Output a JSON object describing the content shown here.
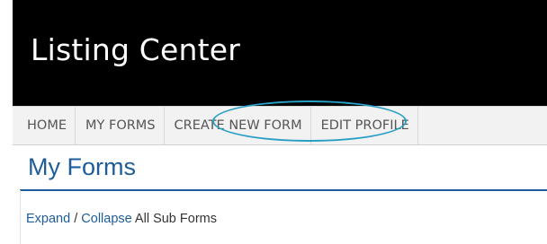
{
  "header": {
    "title": "Listing Center"
  },
  "nav": {
    "items": [
      {
        "label": "HOME"
      },
      {
        "label": "MY FORMS"
      },
      {
        "label": "CREATE NEW FORM"
      },
      {
        "label": "EDIT PROFILE"
      }
    ],
    "highlighted": "CREATE NEW FORM"
  },
  "main": {
    "page_title": "My Forms",
    "expand_label": "Expand",
    "separator": " / ",
    "collapse_label": "Collapse",
    "suffix_text": " All Sub Forms"
  },
  "colors": {
    "header_bg": "#000000",
    "link": "#1d5d99",
    "highlight_ring": "#2a9fc6"
  }
}
